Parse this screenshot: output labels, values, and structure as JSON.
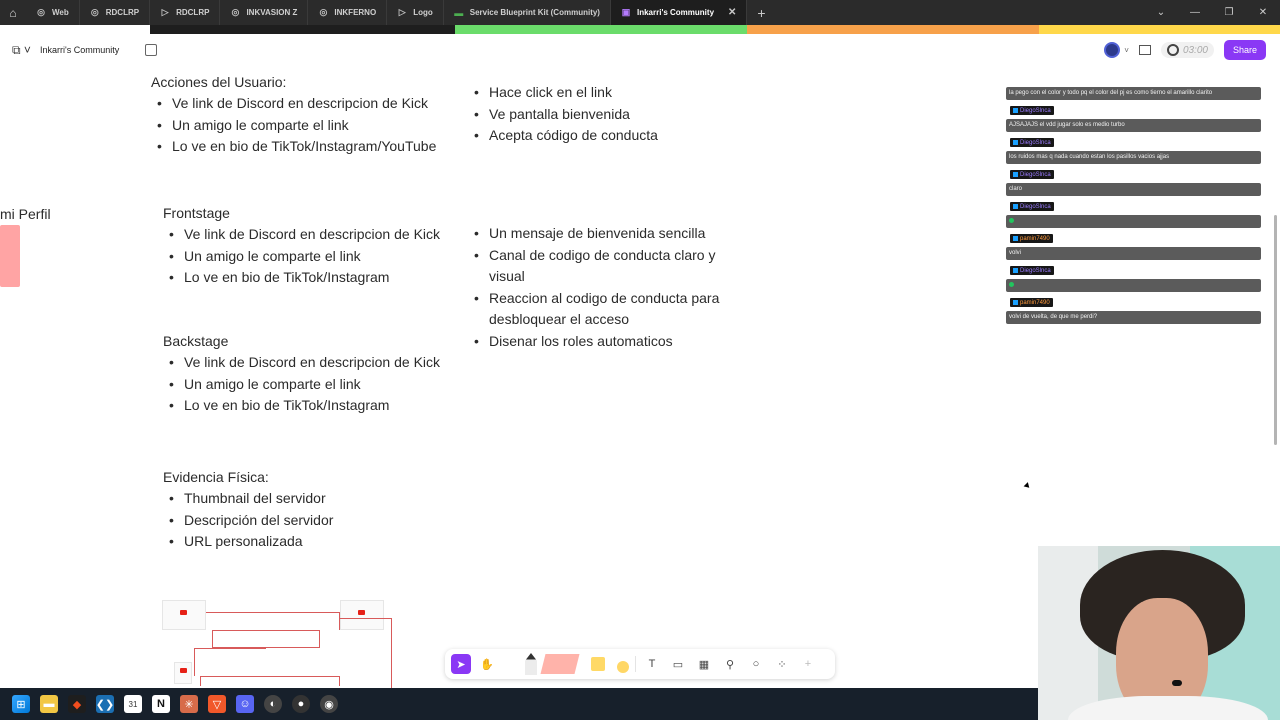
{
  "browser": {
    "tabs": [
      {
        "label": "Web",
        "icon": "figma-icon"
      },
      {
        "label": "RDCLRP",
        "icon": "figma-icon"
      },
      {
        "label": "RDCLRP",
        "icon": "play-icon"
      },
      {
        "label": "INKVASION Z",
        "icon": "figma-icon"
      },
      {
        "label": "INKFERNO",
        "icon": "figma-icon"
      },
      {
        "label": "Logo",
        "icon": "play-icon"
      },
      {
        "label": "Service Blueprint Kit (Community)",
        "icon": "figjam-icon"
      },
      {
        "label": "Inkarri's Community",
        "icon": "figjam-icon",
        "active": true
      }
    ],
    "close_glyph": "✕",
    "new_tab_glyph": "+"
  },
  "strip_colors": [
    "#1e1e1e",
    "#6bdc6b",
    "#f7a14a",
    "#ffd84a"
  ],
  "figjam": {
    "file_title": "Inkarri's Community",
    "timer": "03:00",
    "share_label": "Share"
  },
  "canvas": {
    "offcanvas_text": "mi Perfil",
    "acciones": {
      "heading": "Acciones del Usuario:",
      "items": [
        "Ve link de Discord en descripcion de Kick",
        "Un amigo le comparte el link",
        "Lo ve en bio de TikTok/Instagram/YouTube"
      ],
      "right_items": [
        "Hace click en el link",
        "Ve pantalla bienvenida",
        "Acepta código de conducta"
      ]
    },
    "frontstage": {
      "heading": "Frontstage",
      "items": [
        "Ve link de Discord en descripcion de Kick",
        "Un amigo le comparte el link",
        "Lo ve en bio de TikTok/Instagram"
      ],
      "right_items": [
        "Un mensaje de bienvenida sencilla",
        "Canal de codigo de conducta claro y visual",
        "Reaccion al codigo de conducta para desbloquear el acceso",
        "Disenar los roles automaticos"
      ]
    },
    "backstage": {
      "heading": "Backstage",
      "items": [
        "Ve link de Discord en descripcion de Kick",
        "Un amigo le comparte el link",
        "Lo ve en bio de TikTok/Instagram"
      ]
    },
    "evidencia": {
      "heading": "Evidencia Física:",
      "items": [
        "Thumbnail del servidor",
        "Descripción del servidor",
        "URL personalizada"
      ]
    }
  },
  "chat": [
    {
      "user": "",
      "text": "la pego con el color y todo pq el color del pj es como tierno el amarillo clarito"
    },
    {
      "user": "DiegoSlnca",
      "text": "AJSAJAJS el vdd jugar solo es medio turbo"
    },
    {
      "user": "DiegoSlnca",
      "text": "los ruidos mas q nada cuando estan los pasillos vacios ajjas"
    },
    {
      "user": "DiegoSlnca",
      "text": "claro"
    },
    {
      "user": "DiegoSlnca",
      "text": "",
      "emote": true
    },
    {
      "user": "pamin7490",
      "text": "volvi",
      "orange": true
    },
    {
      "user": "DiegoSlnca",
      "text": "",
      "emote": true
    },
    {
      "user": "pamin7490",
      "text": "volvi de vuelta, de que me perdi?",
      "orange": true
    }
  ]
}
